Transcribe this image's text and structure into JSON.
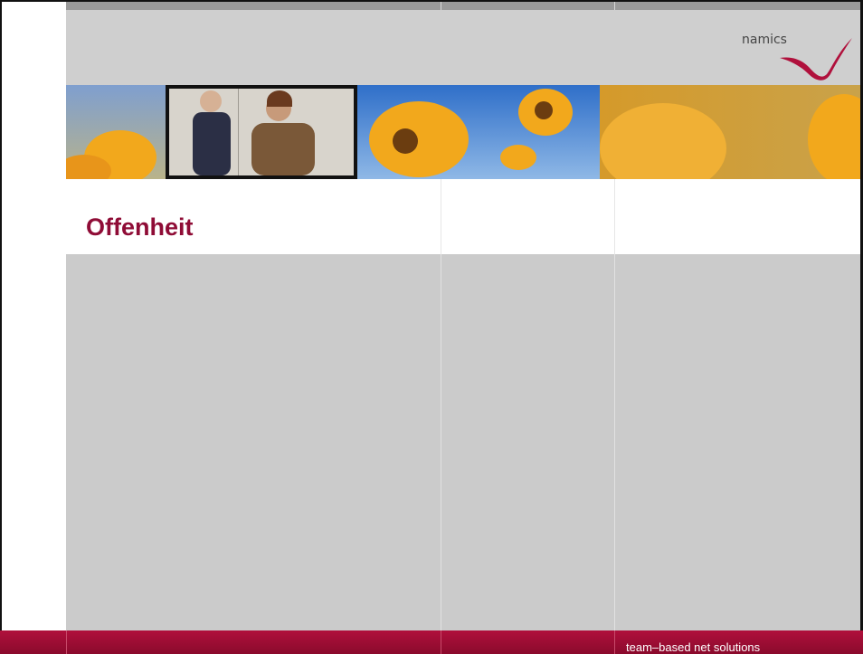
{
  "slide": {
    "title": "Offenheit"
  },
  "logo": {
    "text": "namics",
    "icon": "swoosh-logo-icon",
    "color": "#b0103c"
  },
  "footer": {
    "tagline": "team–based net solutions",
    "color": "#9e0d34"
  },
  "banner": {
    "description_icon": "sunflower-photo-banner"
  }
}
